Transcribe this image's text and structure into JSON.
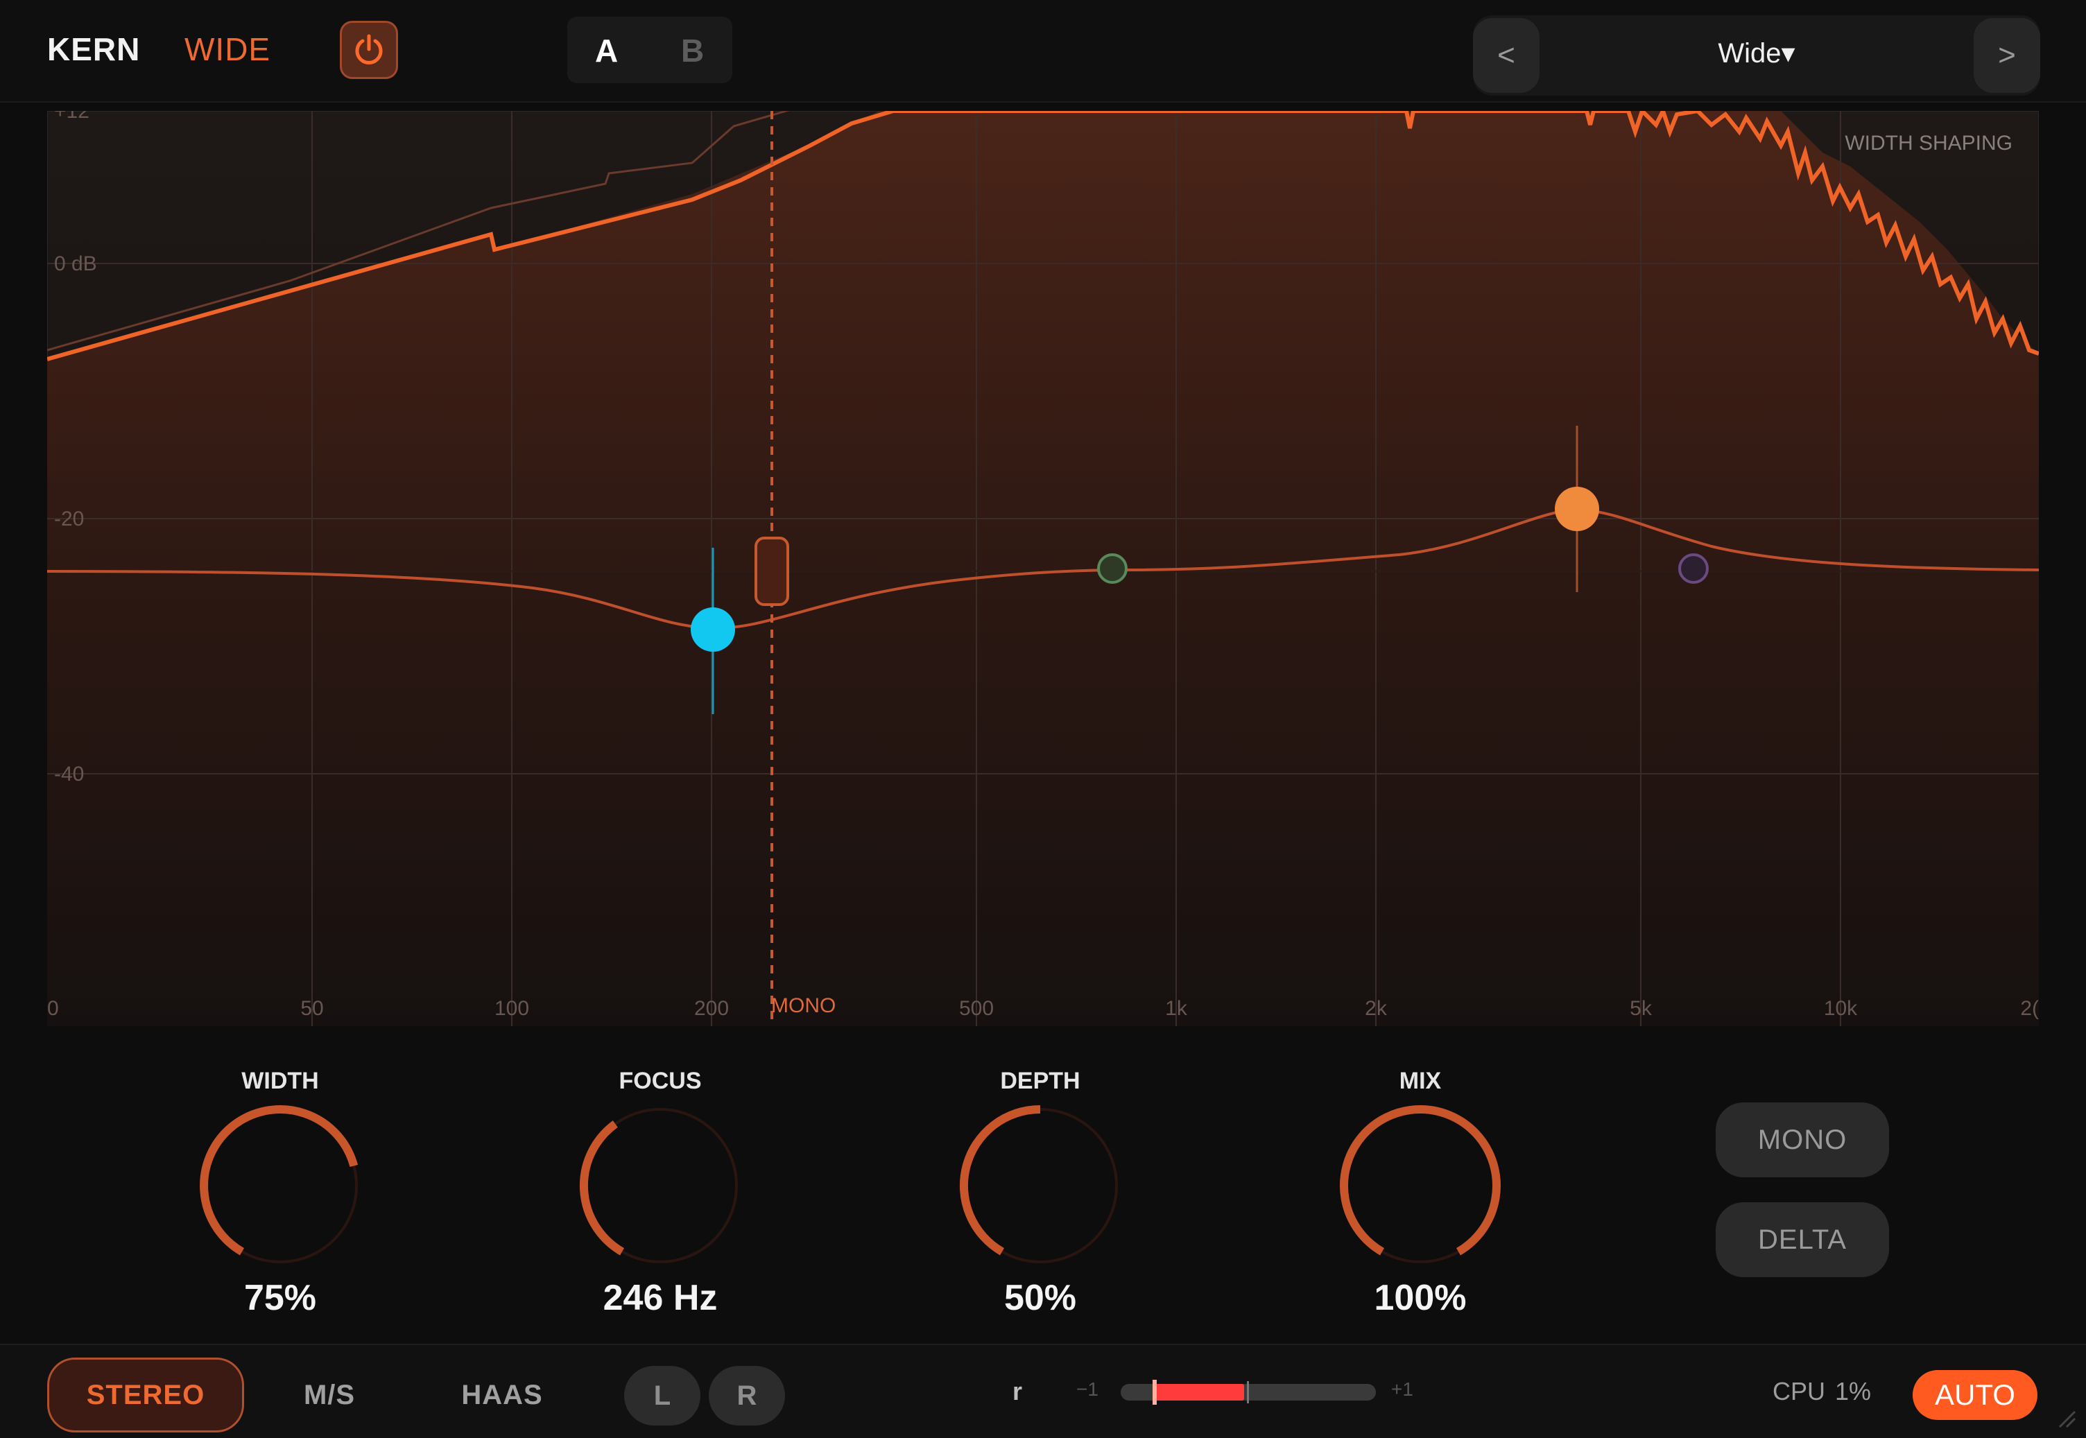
{
  "header": {
    "brand_name": "KERN",
    "plugin_name": "WIDE",
    "ab": {
      "a": "A",
      "b": "B",
      "active": "A"
    },
    "preset": {
      "prev": "<",
      "name": "Wide▾",
      "next": ">"
    }
  },
  "graph": {
    "panel_label": "WIDTH SHAPING",
    "y_labels": [
      "+12",
      "0 dB",
      "-20",
      "-40"
    ],
    "x_labels": [
      "0",
      "50",
      "100",
      "200",
      "500",
      "1k",
      "2k",
      "5k",
      "10k",
      "2("
    ],
    "crossover_label": "MONO",
    "nodes": [
      {
        "name": "low-band-node",
        "color": "#12c8f0"
      },
      {
        "name": "low-mid-band-node",
        "color": "#5a8a5a"
      },
      {
        "name": "high-band-node",
        "color": "#f08a3c"
      },
      {
        "name": "air-band-node",
        "color": "#6a4a80"
      }
    ],
    "colors": {
      "curve": "#f06428",
      "fill_top": "#4a2418",
      "fill_bottom": "#1a1210"
    }
  },
  "knobs": [
    {
      "label": "WIDTH",
      "value": "75%",
      "level": 0.75
    },
    {
      "label": "FOCUS",
      "value": "246 Hz",
      "level": 0.38
    },
    {
      "label": "DEPTH",
      "value": "50%",
      "level": 0.5
    },
    {
      "label": "MIX",
      "value": "100%",
      "level": 1.0
    }
  ],
  "buttons": {
    "mono": "MONO",
    "delta": "DELTA"
  },
  "footer": {
    "modes": {
      "stereo": "STEREO",
      "ms": "M/S",
      "haas": "HAAS",
      "active": "STEREO"
    },
    "l": "L",
    "r": "R",
    "correlation": {
      "label": "r",
      "min": "−1",
      "max": "+1"
    },
    "cpu_label": "CPU",
    "cpu_value": "1%",
    "auto": "AUTO"
  },
  "accent_color": "#ee6a30"
}
